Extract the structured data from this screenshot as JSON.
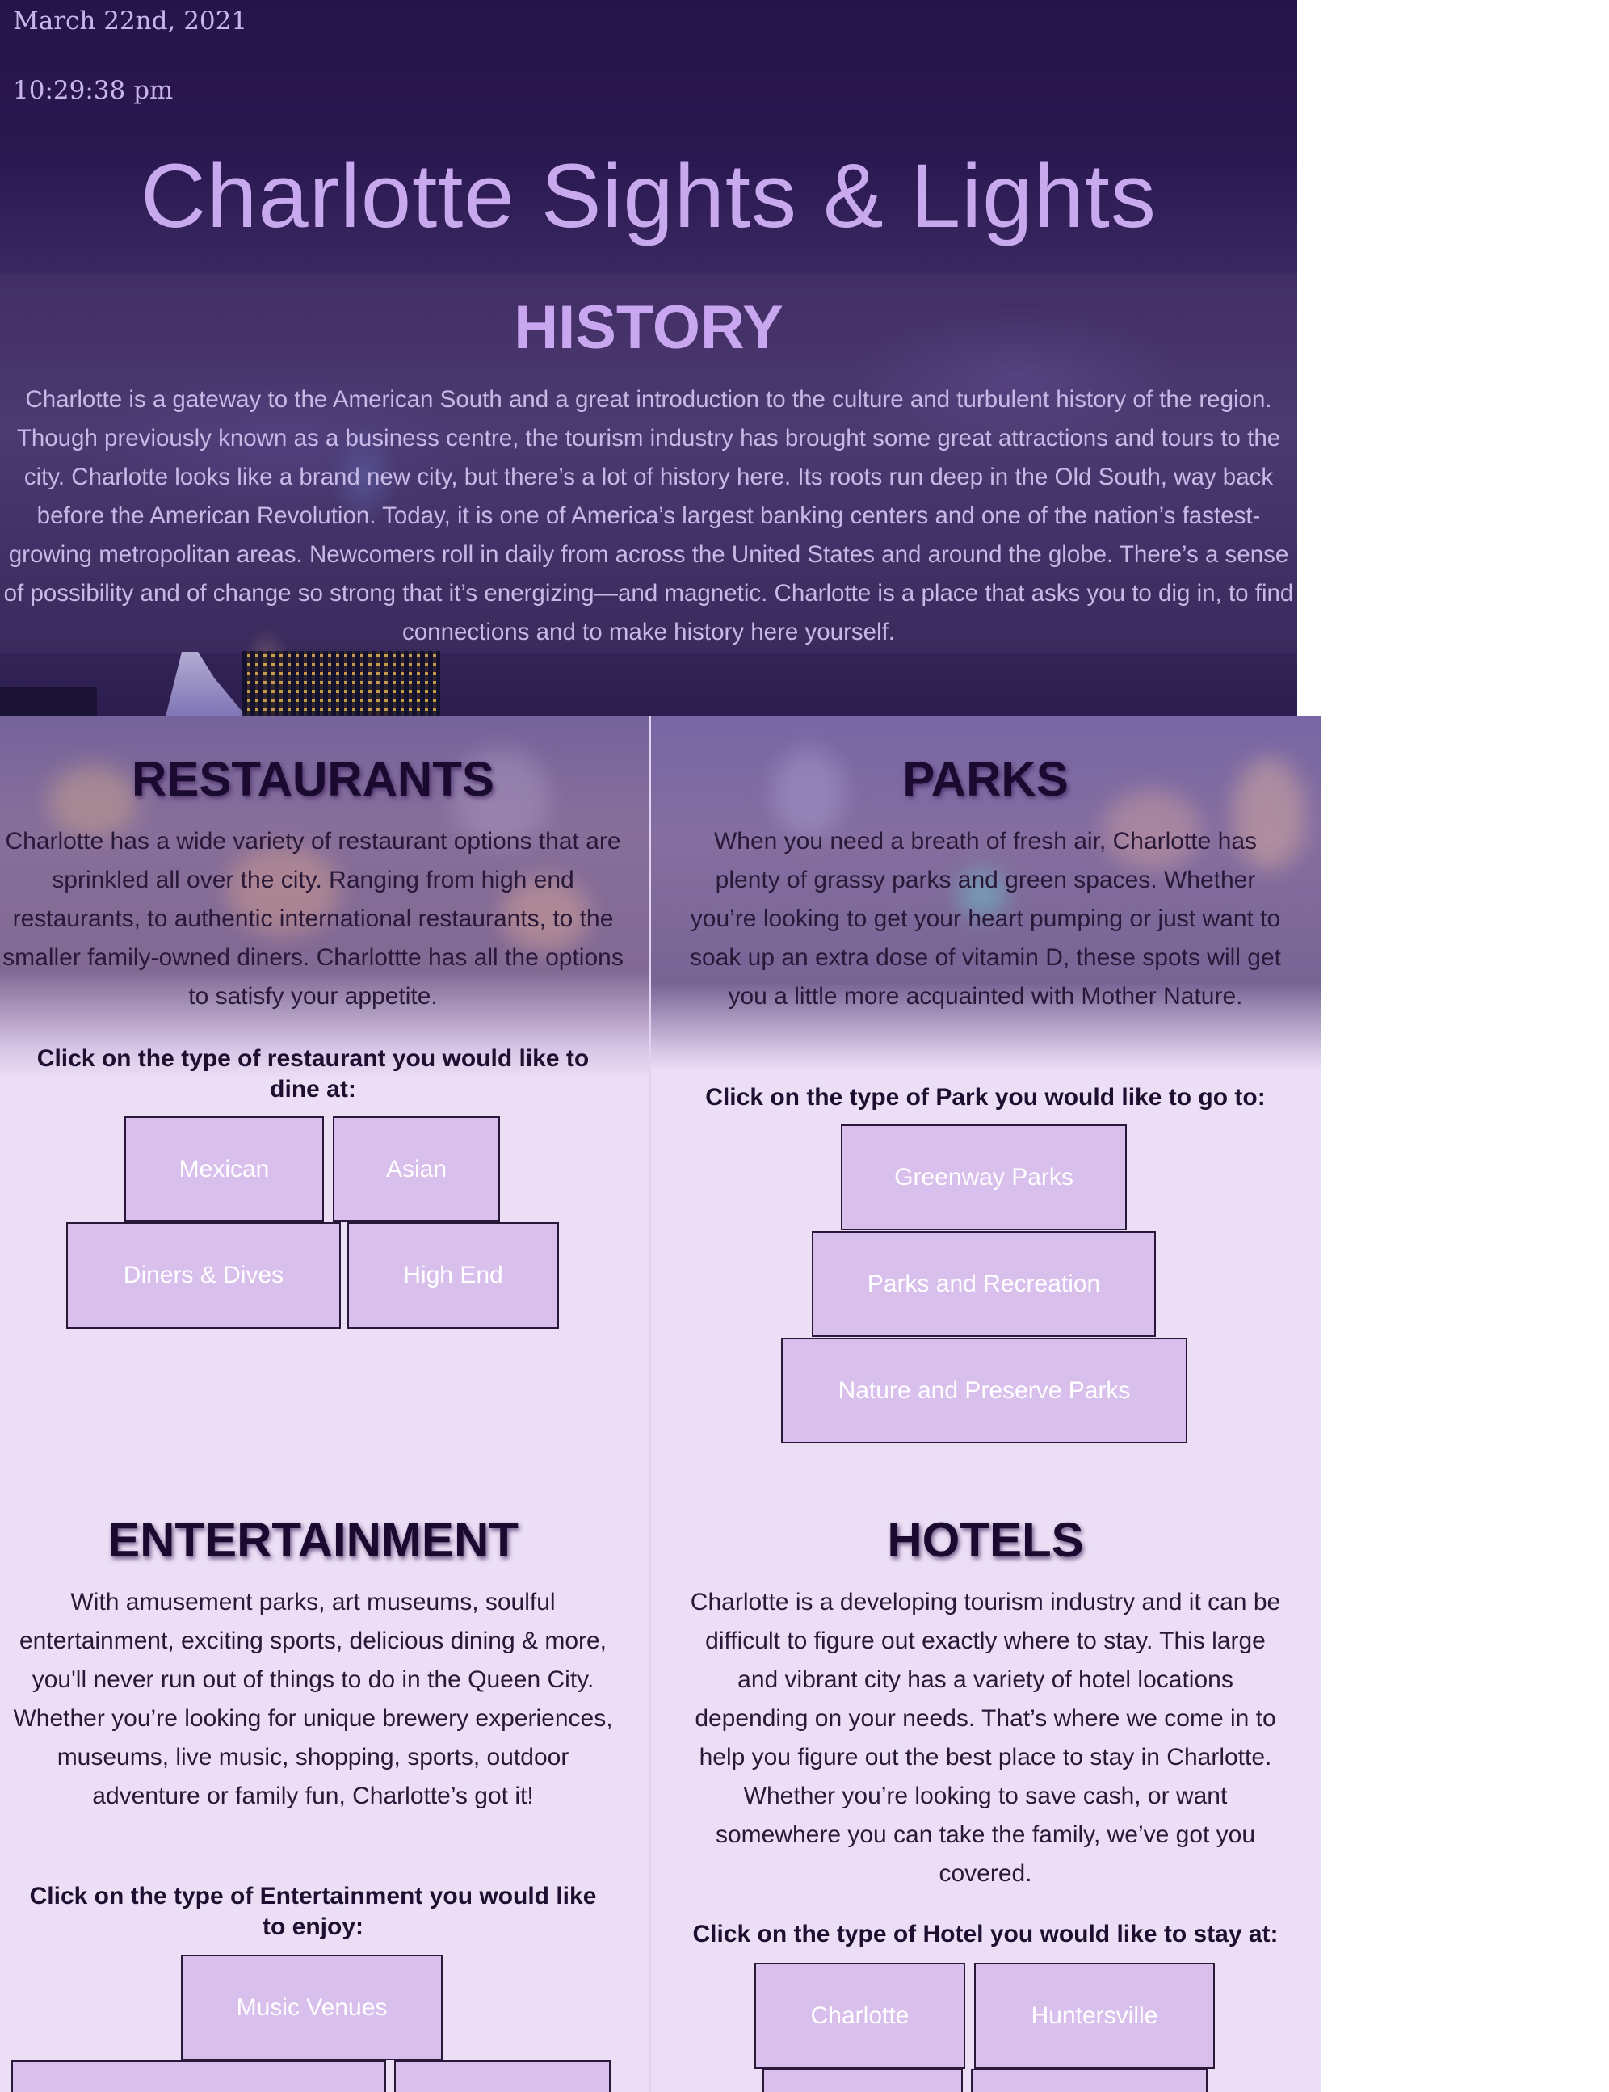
{
  "header": {
    "date": "March 22nd, 2021",
    "time": "10:29:38 pm",
    "title": "Charlotte Sights & Lights"
  },
  "history": {
    "heading": "HISTORY",
    "body": "Charlotte is a gateway to the American South and a great introduction to the culture and turbulent history of the region. Though previously known as a business centre, the tourism industry has brought some great attractions and tours to the city. Charlotte looks like a brand new city, but there’s a lot of history here. Its roots run deep in the Old South, way back before the American Revolution. Today, it is one of America’s largest banking centers and one of the nation’s fastest-growing metropolitan areas. Newcomers roll in daily from across the United States and around the globe. There’s a sense of possibility and of change so strong that it’s energizing—and magnetic. Charlotte is a place that asks you to dig in, to find connections and to make history here yourself."
  },
  "restaurants": {
    "heading": "RESTAURANTS",
    "body": "Charlotte has a wide variety of restaurant options that are sprinkled all over the city. Ranging from high end restaurants, to authentic international restaurants, to the smaller family-owned diners. Charlottte has all the options to satisfy your appetite.",
    "prompt": "Click on the type of restaurant you would like to dine at:",
    "buttons": [
      "Mexican",
      "Asian",
      "Diners & Dives",
      "High End"
    ]
  },
  "parks": {
    "heading": "PARKS",
    "body": "When you need a breath of fresh air, Charlotte has plenty of grassy parks and green spaces. Whether you’re looking to get your heart pumping or just want to soak up an extra dose of vitamin D, these spots will get you a little more acquainted with Mother Nature.",
    "prompt": "Click on the type of Park you would like to go to:",
    "buttons": [
      "Greenway Parks",
      "Parks and Recreation",
      "Nature and Preserve Parks"
    ]
  },
  "entertainment": {
    "heading": "ENTERTAINMENT",
    "body": "With amusement parks, art museums, soulful entertainment, exciting sports, delicious dining & more, you'll never run out of things to do in the Queen City. Whether you’re looking for unique brewery experiences, museums, live music, shopping, sports, outdoor adventure or family fun, Charlotte’s got it!",
    "prompt": "Click on the type of Entertainment you would like to enjoy:",
    "buttons": [
      "Music Venues"
    ]
  },
  "hotels": {
    "heading": "HOTELS",
    "body": "Charlotte is a developing tourism industry and it can be difficult to figure out exactly where to stay. This large and vibrant city has a variety of hotel locations depending on your needs. That’s where we come in to help you figure out the best place to stay in Charlotte. Whether you’re looking to save cash, or want somewhere you can take the family, we’ve got you covered.",
    "prompt": "Click on the type of Hotel you would like to stay at:",
    "buttons": [
      "Charlotte",
      "Huntersville"
    ]
  },
  "colors": {
    "title": "#c8a9ee",
    "heading_dark": "#1a0a30",
    "button_fill": "#d8bfec",
    "button_text": "#ffffff",
    "section_background": "#ecdff5"
  }
}
